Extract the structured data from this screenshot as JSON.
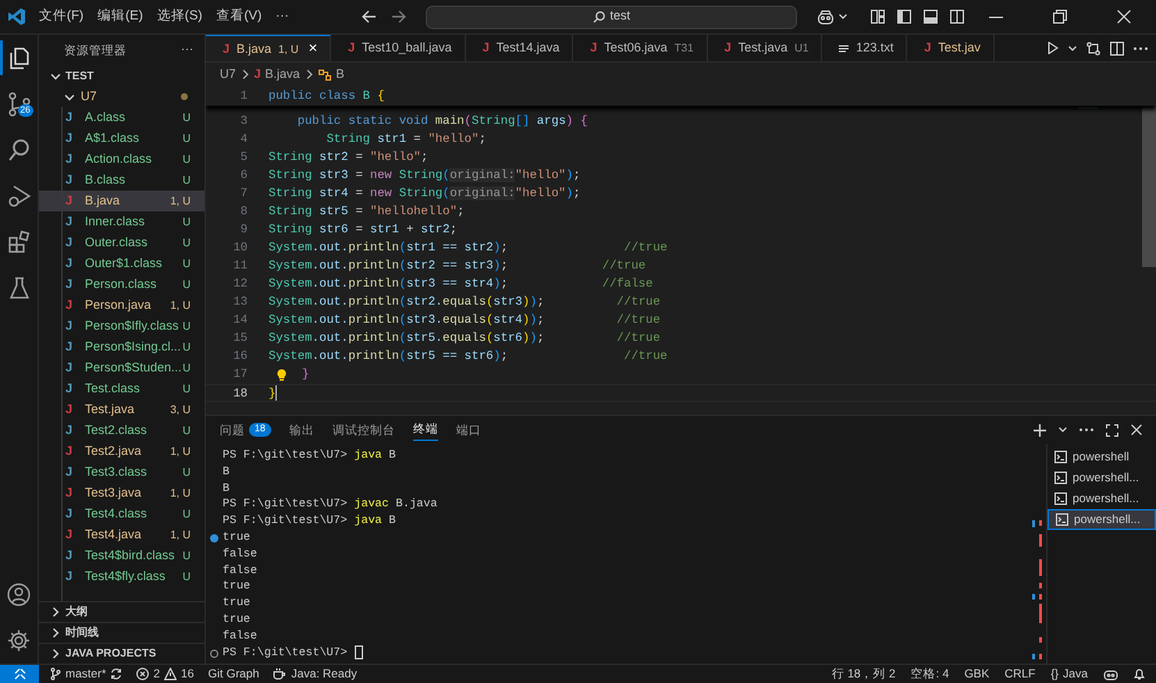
{
  "title_bar": {
    "menus": [
      "文件(F)",
      "编辑(E)",
      "选择(S)",
      "查看(V)"
    ],
    "more": "···",
    "search": {
      "value": "test"
    }
  },
  "activity_bar": {
    "items": [
      {
        "kind": "explorer",
        "selected": true
      },
      {
        "kind": "source-control",
        "selected": false,
        "badge": "26"
      },
      {
        "kind": "search",
        "selected": false
      },
      {
        "kind": "run",
        "selected": false
      },
      {
        "kind": "extensions",
        "selected": false
      },
      {
        "kind": "testing",
        "selected": false
      }
    ]
  },
  "sidebar": {
    "title": "资源管理器",
    "more": "···",
    "root": {
      "label": "TEST",
      "expanded": true
    },
    "folder": {
      "label": "U7",
      "expanded": true,
      "modified": true
    },
    "files": [
      {
        "icon": "J",
        "label": "A.class",
        "kind": "class",
        "badge": "U",
        "selected": false
      },
      {
        "icon": "J",
        "label": "A$1.class",
        "kind": "class",
        "badge": "U",
        "selected": false
      },
      {
        "icon": "J",
        "label": "Action.class",
        "kind": "class",
        "badge": "U",
        "selected": false
      },
      {
        "icon": "J",
        "label": "B.class",
        "kind": "class",
        "badge": "U",
        "selected": false
      },
      {
        "icon": "J",
        "label": "B.java",
        "kind": "java",
        "badge": "1, U",
        "selected": true
      },
      {
        "icon": "J",
        "label": "Inner.class",
        "kind": "class",
        "badge": "U",
        "selected": false
      },
      {
        "icon": "J",
        "label": "Outer.class",
        "kind": "class",
        "badge": "U",
        "selected": false
      },
      {
        "icon": "J",
        "label": "Outer$1.class",
        "kind": "class",
        "badge": "U",
        "selected": false
      },
      {
        "icon": "J",
        "label": "Person.class",
        "kind": "class",
        "badge": "U",
        "selected": false
      },
      {
        "icon": "J",
        "label": "Person.java",
        "kind": "java",
        "badge": "1, U",
        "selected": false
      },
      {
        "icon": "J",
        "label": "Person$Ifly.class",
        "kind": "class",
        "badge": "U",
        "selected": false
      },
      {
        "icon": "J",
        "label": "Person$Ising.cl...",
        "kind": "class",
        "badge": "U",
        "selected": false
      },
      {
        "icon": "J",
        "label": "Person$Studen...",
        "kind": "class",
        "badge": "U",
        "selected": false
      },
      {
        "icon": "J",
        "label": "Test.class",
        "kind": "class",
        "badge": "U",
        "selected": false
      },
      {
        "icon": "J",
        "label": "Test.java",
        "kind": "java",
        "badge": "3, U",
        "selected": false
      },
      {
        "icon": "J",
        "label": "Test2.class",
        "kind": "class",
        "badge": "U",
        "selected": false
      },
      {
        "icon": "J",
        "label": "Test2.java",
        "kind": "java",
        "badge": "1, U",
        "selected": false
      },
      {
        "icon": "J",
        "label": "Test3.class",
        "kind": "class",
        "badge": "U",
        "selected": false
      },
      {
        "icon": "J",
        "label": "Test3.java",
        "kind": "java",
        "badge": "1, U",
        "selected": false
      },
      {
        "icon": "J",
        "label": "Test4.class",
        "kind": "class",
        "badge": "U",
        "selected": false
      },
      {
        "icon": "J",
        "label": "Test4.java",
        "kind": "java",
        "badge": "1, U",
        "selected": false
      },
      {
        "icon": "J",
        "label": "Test4$bird.class",
        "kind": "class",
        "badge": "U",
        "selected": false
      },
      {
        "icon": "J",
        "label": "Test4$fly.class",
        "kind": "class",
        "badge": "U",
        "selected": false
      }
    ],
    "sections": [
      {
        "label": "大纲",
        "expanded": false
      },
      {
        "label": "时间线",
        "expanded": false
      },
      {
        "label": "JAVA PROJECTS",
        "expanded": false
      }
    ]
  },
  "tabs": [
    {
      "kind": "java",
      "icon": "J",
      "label": "B.java",
      "badge": "1, U",
      "selected": true,
      "decorated": true,
      "close": "×"
    },
    {
      "kind": "java",
      "icon": "J",
      "label": "Test10_ball.java",
      "selected": false,
      "decorated": false
    },
    {
      "kind": "java",
      "icon": "J",
      "label": "Test14.java",
      "selected": false,
      "decorated": false
    },
    {
      "kind": "java",
      "icon": "J",
      "label": "Test06.java",
      "badge": "T31",
      "selected": false,
      "decorated": false
    },
    {
      "kind": "java",
      "icon": "J",
      "label": "Test.java",
      "badge": "U1",
      "selected": false,
      "decorated": false
    },
    {
      "kind": "text",
      "label": "123.txt",
      "selected": false,
      "decorated": false
    },
    {
      "kind": "java",
      "icon": "J",
      "label": "Test.jav",
      "selected": false,
      "decorated": true
    }
  ],
  "breadcrumb": {
    "folder": "U7",
    "file_icon": "J",
    "file": "B.java",
    "symbol": "B"
  },
  "editor": {
    "lines": [
      {
        "number": "1",
        "sticky": true,
        "tokens": [
          {
            "kind": "kw",
            "text": "public class "
          },
          {
            "kind": "type",
            "text": "B "
          },
          {
            "kind": "p1",
            "text": "{"
          }
        ]
      },
      {
        "number": "3",
        "tokens": [
          {
            "kind": "kw",
            "text": "    public static void "
          },
          {
            "kind": "fn",
            "text": "main"
          },
          {
            "kind": "p2",
            "text": "("
          },
          {
            "kind": "type",
            "text": "String"
          },
          {
            "kind": "p3",
            "text": "[]"
          },
          {
            "kind": "var",
            "text": " args"
          },
          {
            "kind": "p2",
            "text": ") {"
          }
        ]
      },
      {
        "number": "4",
        "tokens": [
          {
            "kind": "type",
            "text": "        String "
          },
          {
            "kind": "var",
            "text": "str1"
          },
          {
            "kind": "plain",
            "text": " = "
          },
          {
            "kind": "str",
            "text": "\"hello\""
          },
          {
            "kind": "plain",
            "text": ";"
          }
        ]
      },
      {
        "number": "5",
        "tokens": [
          {
            "kind": "type",
            "text": "String "
          },
          {
            "kind": "var",
            "text": "str2"
          },
          {
            "kind": "plain",
            "text": " = "
          },
          {
            "kind": "str",
            "text": "\"hello\""
          },
          {
            "kind": "plain",
            "text": ";"
          }
        ]
      },
      {
        "number": "6",
        "tokens": [
          {
            "kind": "type",
            "text": "String "
          },
          {
            "kind": "var",
            "text": "str3"
          },
          {
            "kind": "plain",
            "text": " = "
          },
          {
            "kind": "new",
            "text": "new "
          },
          {
            "kind": "type",
            "text": "String"
          },
          {
            "kind": "p3",
            "text": "("
          },
          {
            "kind": "hint",
            "text": "original:"
          },
          {
            "kind": "str",
            "text": "\"hello\""
          },
          {
            "kind": "p3",
            "text": ")"
          },
          {
            "kind": "plain",
            "text": ";"
          }
        ]
      },
      {
        "number": "7",
        "tokens": [
          {
            "kind": "type",
            "text": "String "
          },
          {
            "kind": "var",
            "text": "str4"
          },
          {
            "kind": "plain",
            "text": " = "
          },
          {
            "kind": "new",
            "text": "new "
          },
          {
            "kind": "type",
            "text": "String"
          },
          {
            "kind": "p3",
            "text": "("
          },
          {
            "kind": "hint",
            "text": "original:"
          },
          {
            "kind": "str",
            "text": "\"hello\""
          },
          {
            "kind": "p3",
            "text": ")"
          },
          {
            "kind": "plain",
            "text": ";"
          }
        ]
      },
      {
        "number": "8",
        "tokens": [
          {
            "kind": "type",
            "text": "String "
          },
          {
            "kind": "var",
            "text": "str5"
          },
          {
            "kind": "plain",
            "text": " = "
          },
          {
            "kind": "str",
            "text": "\"hellohello\""
          },
          {
            "kind": "plain",
            "text": ";"
          }
        ]
      },
      {
        "number": "9",
        "tokens": [
          {
            "kind": "type",
            "text": "String "
          },
          {
            "kind": "var",
            "text": "str6"
          },
          {
            "kind": "plain",
            "text": " = "
          },
          {
            "kind": "var",
            "text": "str1"
          },
          {
            "kind": "plain",
            "text": " + "
          },
          {
            "kind": "var",
            "text": "str2"
          },
          {
            "kind": "plain",
            "text": ";"
          }
        ]
      },
      {
        "number": "10",
        "tokens": [
          {
            "kind": "type",
            "text": "System"
          },
          {
            "kind": "var",
            "text": ".out."
          },
          {
            "kind": "fn",
            "text": "println"
          },
          {
            "kind": "p3",
            "text": "("
          },
          {
            "kind": "var",
            "text": "str1 == str2"
          },
          {
            "kind": "p3",
            "text": ")"
          },
          {
            "kind": "plain",
            "text": ";"
          },
          {
            "kind": "cmt",
            "text": "                //true"
          }
        ]
      },
      {
        "number": "11",
        "tokens": [
          {
            "kind": "type",
            "text": "System"
          },
          {
            "kind": "var",
            "text": ".out."
          },
          {
            "kind": "fn",
            "text": "println"
          },
          {
            "kind": "p3",
            "text": "("
          },
          {
            "kind": "var",
            "text": "str2 == str3"
          },
          {
            "kind": "p3",
            "text": ")"
          },
          {
            "kind": "plain",
            "text": ";"
          },
          {
            "kind": "cmt",
            "text": "             //true"
          }
        ]
      },
      {
        "number": "12",
        "tokens": [
          {
            "kind": "type",
            "text": "System"
          },
          {
            "kind": "var",
            "text": ".out."
          },
          {
            "kind": "fn",
            "text": "println"
          },
          {
            "kind": "p3",
            "text": "("
          },
          {
            "kind": "var",
            "text": "str3 == str4"
          },
          {
            "kind": "p3",
            "text": ")"
          },
          {
            "kind": "plain",
            "text": ";"
          },
          {
            "kind": "cmt",
            "text": "             //false"
          }
        ]
      },
      {
        "number": "13",
        "tokens": [
          {
            "kind": "type",
            "text": "System"
          },
          {
            "kind": "var",
            "text": ".out."
          },
          {
            "kind": "fn",
            "text": "println"
          },
          {
            "kind": "p3",
            "text": "("
          },
          {
            "kind": "var",
            "text": "str2."
          },
          {
            "kind": "fn",
            "text": "equals"
          },
          {
            "kind": "p1",
            "text": "("
          },
          {
            "kind": "var",
            "text": "str3"
          },
          {
            "kind": "p1",
            "text": ")"
          },
          {
            "kind": "p3",
            "text": ")"
          },
          {
            "kind": "plain",
            "text": ";"
          },
          {
            "kind": "cmt",
            "text": "          //true"
          }
        ]
      },
      {
        "number": "14",
        "tokens": [
          {
            "kind": "type",
            "text": "System"
          },
          {
            "kind": "var",
            "text": ".out."
          },
          {
            "kind": "fn",
            "text": "println"
          },
          {
            "kind": "p3",
            "text": "("
          },
          {
            "kind": "var",
            "text": "str3."
          },
          {
            "kind": "fn",
            "text": "equals"
          },
          {
            "kind": "p1",
            "text": "("
          },
          {
            "kind": "var",
            "text": "str4"
          },
          {
            "kind": "p1",
            "text": ")"
          },
          {
            "kind": "p3",
            "text": ")"
          },
          {
            "kind": "plain",
            "text": ";"
          },
          {
            "kind": "cmt",
            "text": "          //true"
          }
        ]
      },
      {
        "number": "15",
        "tokens": [
          {
            "kind": "type",
            "text": "System"
          },
          {
            "kind": "var",
            "text": ".out."
          },
          {
            "kind": "fn",
            "text": "println"
          },
          {
            "kind": "p3",
            "text": "("
          },
          {
            "kind": "var",
            "text": "str5."
          },
          {
            "kind": "fn",
            "text": "equals"
          },
          {
            "kind": "p1",
            "text": "("
          },
          {
            "kind": "var",
            "text": "str6"
          },
          {
            "kind": "p1",
            "text": ")"
          },
          {
            "kind": "p3",
            "text": ")"
          },
          {
            "kind": "plain",
            "text": ";"
          },
          {
            "kind": "cmt",
            "text": "          //true"
          }
        ]
      },
      {
        "number": "16",
        "tokens": [
          {
            "kind": "type",
            "text": "System"
          },
          {
            "kind": "var",
            "text": ".out."
          },
          {
            "kind": "fn",
            "text": "println"
          },
          {
            "kind": "p3",
            "text": "("
          },
          {
            "kind": "var",
            "text": "str5 == str6"
          },
          {
            "kind": "p3",
            "text": ")"
          },
          {
            "kind": "plain",
            "text": ";"
          },
          {
            "kind": "cmt",
            "text": "                //true"
          }
        ]
      },
      {
        "number": "17",
        "lightbulb": true,
        "tokens": [
          {
            "kind": "p2",
            "text": "}"
          }
        ]
      },
      {
        "number": "18",
        "current": true,
        "tokens": [
          {
            "kind": "p1",
            "text": "}"
          }
        ]
      }
    ]
  },
  "panel": {
    "tabs": [
      {
        "label": "问题",
        "badge": "18",
        "selected": false
      },
      {
        "label": "输出",
        "selected": false
      },
      {
        "label": "调试控制台",
        "selected": false
      },
      {
        "label": "终端",
        "selected": true
      },
      {
        "label": "端口",
        "selected": false
      }
    ],
    "terminal": {
      "lines": [
        {
          "tokens": [
            {
              "kind": "prompt",
              "text": "PS F:\\git\\test\\U7> "
            },
            {
              "kind": "cmd",
              "text": "java "
            },
            {
              "kind": "arg",
              "text": "B"
            }
          ]
        },
        {
          "tokens": [
            {
              "kind": "out",
              "text": "B"
            }
          ]
        },
        {
          "tokens": [
            {
              "kind": "out",
              "text": "B"
            }
          ]
        },
        {
          "tokens": [
            {
              "kind": "prompt",
              "text": "PS F:\\git\\test\\U7> "
            },
            {
              "kind": "cmd",
              "text": "javac "
            },
            {
              "kind": "arg",
              "text": "B.java"
            }
          ]
        },
        {
          "tokens": [
            {
              "kind": "prompt",
              "text": "PS F:\\git\\test\\U7> "
            },
            {
              "kind": "cmd",
              "text": "java "
            },
            {
              "kind": "arg",
              "text": "B"
            }
          ]
        },
        {
          "decoration": true,
          "success": true,
          "tokens": [
            {
              "kind": "out",
              "text": "true"
            }
          ]
        },
        {
          "tokens": [
            {
              "kind": "out",
              "text": "false"
            }
          ]
        },
        {
          "tokens": [
            {
              "kind": "out",
              "text": "false"
            }
          ]
        },
        {
          "tokens": [
            {
              "kind": "out",
              "text": "true"
            }
          ]
        },
        {
          "tokens": [
            {
              "kind": "out",
              "text": "true"
            }
          ]
        },
        {
          "tokens": [
            {
              "kind": "out",
              "text": "true"
            }
          ]
        },
        {
          "tokens": [
            {
              "kind": "out",
              "text": "false"
            }
          ]
        },
        {
          "decoration": true,
          "success": false,
          "cursor": true,
          "tokens": [
            {
              "kind": "prompt",
              "text": "PS F:\\git\\test\\U7> "
            }
          ]
        }
      ]
    },
    "terminals": [
      {
        "label": "powershell",
        "selected": false
      },
      {
        "label": "powershell...",
        "selected": false
      },
      {
        "label": "powershell...",
        "selected": false
      },
      {
        "label": "powershell...",
        "selected": true
      }
    ]
  },
  "status_bar": {
    "branch": "master*",
    "errors": "2",
    "warnings": "16",
    "git_graph": "Git Graph",
    "java_status": "Java: Ready",
    "position": "行 18，列 2",
    "indent": "空格: 4",
    "encoding": "GBK",
    "eol": "CRLF",
    "language_icon": "{}",
    "language": "Java"
  }
}
